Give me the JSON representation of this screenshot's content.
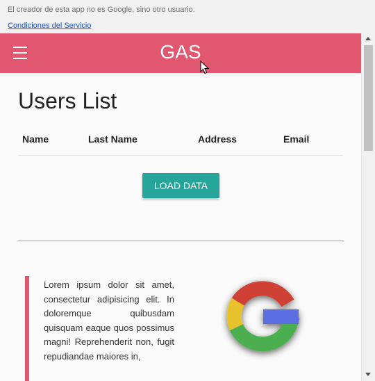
{
  "notice": "El creador de esta app no es Google, sino otro usuario.",
  "terms_link": "Condiciones del Servicio",
  "navbar": {
    "brand": "GAS",
    "menu_icon": "hamburger-menu-icon"
  },
  "page_title": "Users List",
  "table": {
    "columns": [
      "Name",
      "Last Name",
      "Address",
      "Email"
    ],
    "rows": []
  },
  "load_button": "LOAD DATA",
  "quote_text": "Lorem ipsum dolor sit amet, consectetur adipisicing elit. In doloremque quibusdam quisquam eaque quos possimus magni! Reprehenderit non, fugit repudiandae maiores in,",
  "logo_icon": "google-g-logo",
  "colors": {
    "navbar": "#e25770",
    "button": "#26a69a",
    "quote_bar": "#e25770"
  }
}
